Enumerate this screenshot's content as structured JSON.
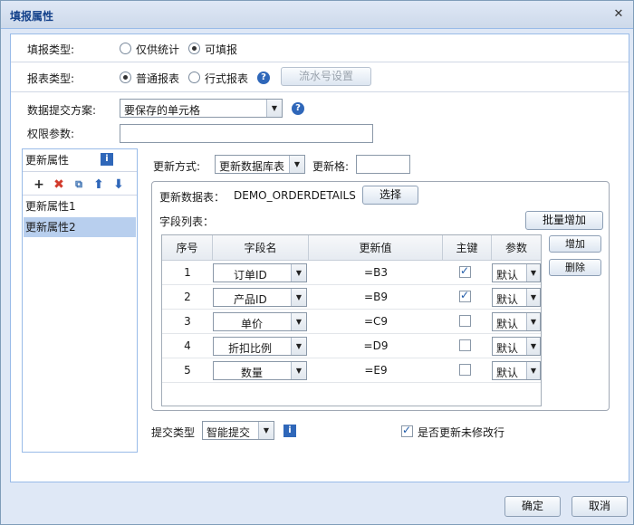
{
  "title": "填报属性",
  "fill_type": {
    "label": "填报类型:",
    "options": [
      "仅供统计",
      "可填报"
    ],
    "selected": "可填报"
  },
  "report_type": {
    "label": "报表类型:",
    "options": [
      "普通报表",
      "行式报表"
    ],
    "selected": "普通报表",
    "serial_button": "流水号设置"
  },
  "submit_scheme": {
    "label": "数据提交方案:",
    "value": "要保存的单元格"
  },
  "permission": {
    "label": "权限参数:",
    "value": ""
  },
  "update_attrs": {
    "title": "更新属性",
    "items": [
      "更新属性1",
      "更新属性2"
    ],
    "selected": "更新属性2"
  },
  "update_mode": {
    "label": "更新方式:",
    "value": "更新数据库表",
    "cell_label": "更新格:",
    "cell_value": ""
  },
  "update_table": {
    "label": "更新数据表：",
    "name": "DEMO_ORDERDETAILS",
    "select_button": "选择"
  },
  "field_list": {
    "label": "字段列表：",
    "batch_add": "批量增加",
    "add": "增加",
    "delete": "删除",
    "columns": [
      "序号",
      "字段名",
      "更新值",
      "主键",
      "参数"
    ],
    "rows": [
      {
        "no": "1",
        "field": "订单ID",
        "value": "=B3",
        "key": true,
        "param": "默认"
      },
      {
        "no": "2",
        "field": "产品ID",
        "value": "=B9",
        "key": true,
        "param": "默认"
      },
      {
        "no": "3",
        "field": "单价",
        "value": "=C9",
        "key": false,
        "param": "默认"
      },
      {
        "no": "4",
        "field": "折扣比例",
        "value": "=D9",
        "key": false,
        "param": "默认"
      },
      {
        "no": "5",
        "field": "数量",
        "value": "=E9",
        "key": false,
        "param": "默认"
      }
    ]
  },
  "submit_type": {
    "label": "提交类型",
    "value": "智能提交",
    "update_unmodified_label": "是否更新未修改行",
    "update_unmodified": true
  },
  "footer": {
    "ok": "确定",
    "cancel": "取消"
  }
}
